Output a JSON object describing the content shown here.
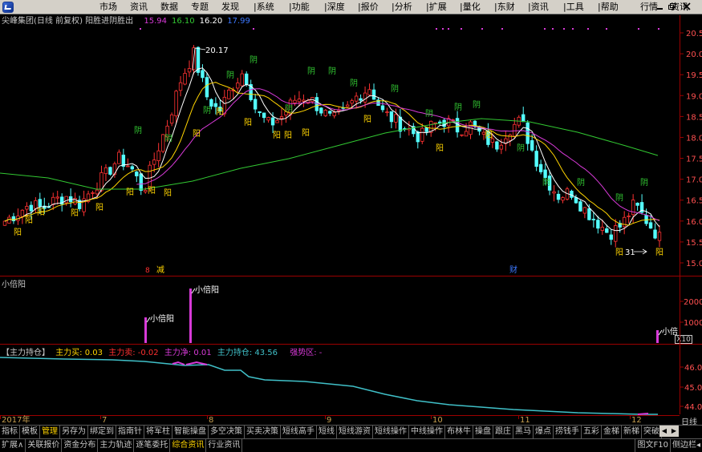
{
  "menu": {
    "items": [
      "市场",
      "资讯",
      "数据",
      "专题",
      "发现",
      "|系统",
      "|功能",
      "|深度",
      "|报价",
      "|分析",
      "|扩展",
      "|量化",
      "|东财",
      "|资讯",
      "|工具",
      "|帮助",
      "行情",
      "资讯"
    ]
  },
  "kline": {
    "stock_name": "尖峰集团",
    "adjust": "(日线 前复权)",
    "indicator_name": "阳胜进阴胜出",
    "ma_values": [
      {
        "label": "15.94",
        "color": "#d83ad8"
      },
      {
        "label": "16.10",
        "color": "#32c832"
      },
      {
        "label": "16.20",
        "color": "#ffffff"
      },
      {
        "label": "17.99",
        "color": "#3c78ff"
      }
    ],
    "price_axis": [
      "20.5",
      "20.0",
      "19.5",
      "19.0",
      "18.5",
      "18.0",
      "17.5",
      "17.0",
      "16.5",
      "16.0",
      "15.5",
      "15.0"
    ],
    "high_label": "20.17",
    "low_label": "31",
    "low_prefix": "阳",
    "event_labels": [
      {
        "text": "8",
        "color": "#ff3030"
      },
      {
        "text": "减",
        "color": "#ffd400"
      },
      {
        "text": "财",
        "color": "#3c78ff"
      }
    ],
    "yin_char": "阴",
    "yang_char": "阳"
  },
  "panel2": {
    "title": "小倍阳",
    "axis": [
      "2000",
      "1000"
    ],
    "marker_label": "小倍阳",
    "marker_label_short": "小倍",
    "x10_label": "X10"
  },
  "panel3": {
    "title": "【主力持仓】",
    "buy": "主力买: 0.03",
    "sell": "主力卖: -0.02",
    "net": "主力净: 0.01",
    "hold": "主力持仓: 43.56",
    "strong_zone": "强势区: -",
    "axis": [
      "46.0",
      "45.0",
      "44.0"
    ],
    "colors": {
      "title": "#c8c8c8",
      "buy": "#ffd400",
      "sell": "#ff3030",
      "net": "#d83ad8",
      "hold": "#40c0c8",
      "strong": "#d83ad8"
    }
  },
  "dates": {
    "labels": [
      "2017年",
      "7",
      "8",
      "9",
      "10",
      "11",
      "12"
    ],
    "freq": "日线"
  },
  "tabs_row1": [
    "指标",
    "模板",
    "管理",
    "另存为",
    "绑定到",
    "指南针",
    "将军柱",
    "智能操盘",
    "多空决策",
    "买卖决策",
    "短线高手",
    "短线",
    "短线游资",
    "短线操作",
    "中线操作",
    "布林牛",
    "操盘",
    "跟庄",
    "黑马",
    "爆点",
    "捞钱手",
    "五彩",
    "金梯",
    "新梯",
    "突破"
  ],
  "tabs_row1_active": "管理",
  "tabs_row2": [
    "扩展∧",
    "关联报价",
    "资金分布",
    "主力轨迹",
    "逐笔委托",
    "综合资讯",
    "行业资讯"
  ],
  "tabs_row2_active": "综合资讯",
  "tabs_row2_right": [
    "图文F10",
    "侧边栏◂"
  ],
  "colors": {
    "up": "#ff3232",
    "down": "#54ffff",
    "ma5": "#ffffff",
    "ma10": "#ffd400",
    "ma20": "#d83ad8",
    "ma60": "#32c832",
    "hold": "#40c0c8",
    "grid_axis": "#9c0000",
    "yin_label": "#32c832",
    "yang_label": "#ffd400"
  }
}
